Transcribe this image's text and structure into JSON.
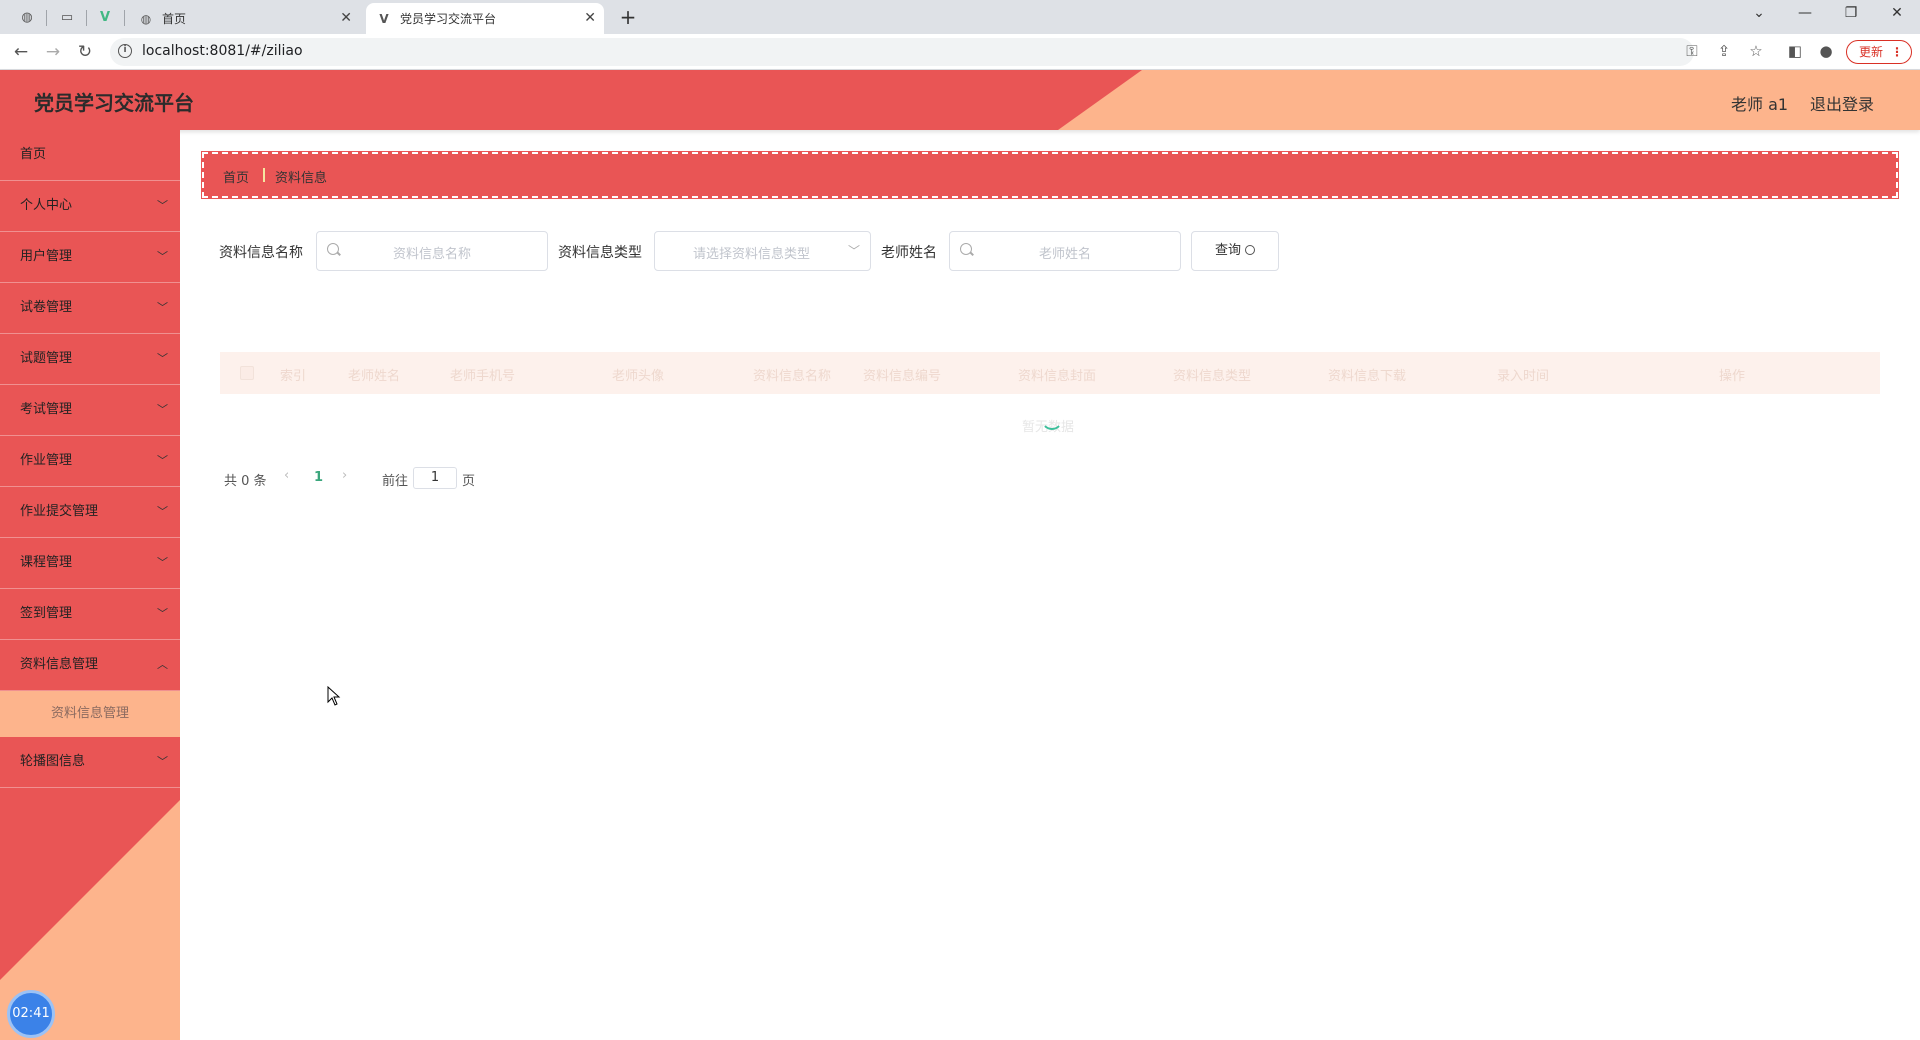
{
  "browser": {
    "tabs": [
      {
        "title": "首页",
        "active": false
      },
      {
        "title": "党员学习交流平台",
        "active": true
      }
    ],
    "url": "localhost:8081/#/ziliao",
    "update_label": "更新"
  },
  "header": {
    "title": "党员学习交流平台",
    "user": "老师 a1",
    "logout": "退出登录",
    "colors": {
      "primary": "#e95555",
      "accent": "#fdb48c"
    }
  },
  "sidebar": {
    "items": [
      {
        "label": "首页",
        "expandable": false
      },
      {
        "label": "个人中心",
        "expandable": true
      },
      {
        "label": "用户管理",
        "expandable": true
      },
      {
        "label": "试卷管理",
        "expandable": true
      },
      {
        "label": "试题管理",
        "expandable": true
      },
      {
        "label": "考试管理",
        "expandable": true
      },
      {
        "label": "作业管理",
        "expandable": true
      },
      {
        "label": "作业提交管理",
        "expandable": true
      },
      {
        "label": "课程管理",
        "expandable": true
      },
      {
        "label": "签到管理",
        "expandable": true
      },
      {
        "label": "资料信息管理",
        "expandable": true,
        "expanded": true
      },
      {
        "label": "轮播图信息",
        "expandable": true
      }
    ],
    "submenu": {
      "label": "资料信息管理"
    },
    "clock": "02:41"
  },
  "breadcrumb": {
    "home": "首页",
    "current": "资料信息"
  },
  "filters": {
    "name_label": "资料信息名称",
    "name_placeholder": "资料信息名称",
    "type_label": "资料信息类型",
    "type_placeholder": "请选择资料信息类型",
    "teacher_label": "老师姓名",
    "teacher_placeholder": "老师姓名",
    "query_label": "查询"
  },
  "table": {
    "columns": [
      "索引",
      "老师姓名",
      "老师手机号",
      "老师头像",
      "资料信息名称",
      "资料信息编号",
      "资料信息封面",
      "资料信息类型",
      "资料信息下载",
      "录入时间",
      "操作"
    ],
    "empty_text": "暂无数据"
  },
  "pagination": {
    "total": "共 0 条",
    "current_page": "1",
    "goto_label": "前往",
    "goto_value": "1",
    "page_suffix": "页"
  }
}
